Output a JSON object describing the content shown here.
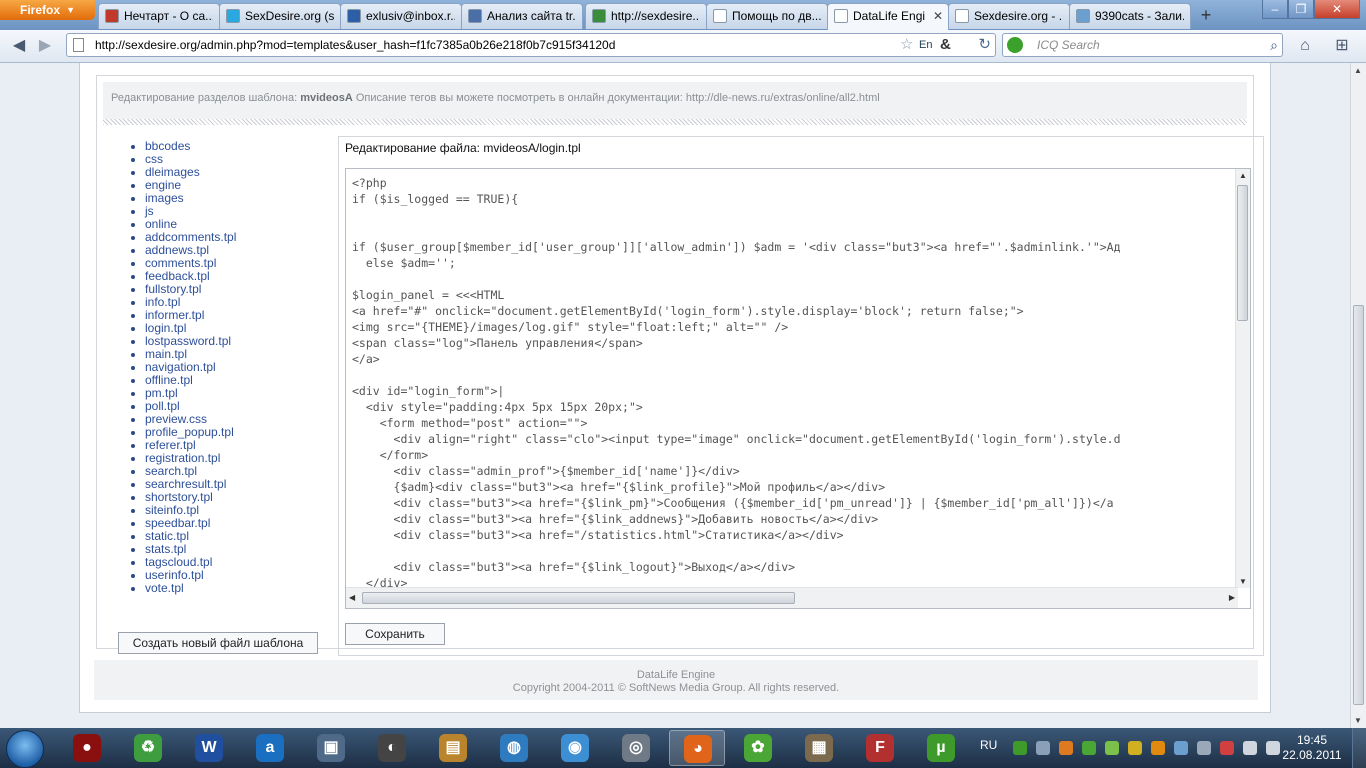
{
  "browser": {
    "menu_button": "Firefox",
    "tabs": [
      {
        "label": "Нечтарт - О са...",
        "icon": "chart-icon",
        "color": "#c0392b"
      },
      {
        "label": "SexDesire.org (s...",
        "icon": "twitter-bird-icon",
        "color": "#2aa9e0"
      },
      {
        "label": "exlusiv@inbox.r...",
        "icon": "mail-at-icon",
        "color": "#2d5fa6"
      },
      {
        "label": "Анализ сайта tr...",
        "icon": "pen-icon",
        "color": "#4a6fa8"
      },
      {
        "label": "http://sexdesire....",
        "icon": "google-icon",
        "color": "#3a8d3a"
      },
      {
        "label": "Помощь по дв...",
        "icon": "page-icon",
        "color": "#ffffff"
      },
      {
        "label": "DataLife Engi...",
        "icon": "page-icon",
        "color": "#ffffff",
        "active": true
      },
      {
        "label": "Sexdesire.org - ...",
        "icon": "page-icon",
        "color": "#ffffff"
      },
      {
        "label": "9390cats - Зали...",
        "icon": "image-icon",
        "color": "#6a9fd0"
      }
    ],
    "new_tab": "+",
    "url": "http://sexdesire.org/admin.php?mod=templates&user_hash=f1fc7385a0b26e218f0b7c915f34120d",
    "lang_badge": "En",
    "search_placeholder": "ICQ Search"
  },
  "page": {
    "header_prefix": "Редактирование разделов шаблона:",
    "template_name": "mvideosA",
    "header_suffix": "Описание тегов вы можете посмотреть в онлайн документации: http://dle-news.ru/extras/online/all2.html",
    "files": [
      "bbcodes",
      "css",
      "dleimages",
      "engine",
      "images",
      "js",
      "online",
      "addcomments.tpl",
      "addnews.tpl",
      "comments.tpl",
      "feedback.tpl",
      "fullstory.tpl",
      "info.tpl",
      "informer.tpl",
      "login.tpl",
      "lostpassword.tpl",
      "main.tpl",
      "navigation.tpl",
      "offline.tpl",
      "pm.tpl",
      "poll.tpl",
      "preview.css",
      "profile_popup.tpl",
      "referer.tpl",
      "registration.tpl",
      "search.tpl",
      "searchresult.tpl",
      "shortstory.tpl",
      "siteinfo.tpl",
      "speedbar.tpl",
      "static.tpl",
      "stats.tpl",
      "tagscloud.tpl",
      "userinfo.tpl",
      "vote.tpl"
    ],
    "new_file_button": "Создать новый файл шаблона",
    "editor_title": "Редактирование файла: mvideosA/login.tpl",
    "code_lines": [
      "<?php",
      "if ($is_logged == TRUE){",
      "",
      "",
      "if ($user_group[$member_id['user_group']]['allow_admin']) $adm = '<div class=\"but3\"><a href=\"'.$adminlink.'\">Ад",
      "  else $adm='';",
      "",
      "$login_panel = <<<HTML",
      "<a href=\"#\" onclick=\"document.getElementById('login_form').style.display='block'; return false;\">",
      "<img src=\"{THEME}/images/log.gif\" style=\"float:left;\" alt=\"\" />",
      "<span class=\"log\">Панель управления</span>",
      "</a>",
      "",
      "<div id=\"login_form\">|",
      "  <div style=\"padding:4px 5px 15px 20px;\">",
      "    <form method=\"post\" action=\"\">",
      "      <div align=\"right\" class=\"clo\"><input type=\"image\" onclick=\"document.getElementById('login_form').style.d",
      "    </form>",
      "      <div class=\"admin_prof\">{$member_id['name']}</div>",
      "      {$adm}<div class=\"but3\"><a href=\"{$link_profile}\">Мой профиль</a></div>",
      "      <div class=\"but3\"><a href=\"{$link_pm}\">Сообщения ({$member_id['pm_unread']} | {$member_id['pm_all']})</a",
      "      <div class=\"but3\"><a href=\"{$link_addnews}\">Добавить новость</a></div>",
      "      <div class=\"but3\"><a href=\"/statistics.html\">Статистика</a></div>",
      "",
      "      <div class=\"but3\"><a href=\"{$link_logout}\">Выход</a></div>",
      "  </div>"
    ],
    "save_button": "Сохранить",
    "footer_line1": "DataLife Engine",
    "footer_line2": "Copyright 2004-2011 © SoftNews Media Group. All rights reserved."
  },
  "taskbar": {
    "apps": [
      {
        "name": "app-red-icon",
        "glyph": "●",
        "color": "#8a1010"
      },
      {
        "name": "recycle-icon",
        "glyph": "♻",
        "color": "#3e9d3e"
      },
      {
        "name": "word-icon",
        "glyph": "W",
        "color": "#1f4f9e"
      },
      {
        "name": "app-a-icon",
        "glyph": "a",
        "color": "#1a6fc0"
      },
      {
        "name": "computer-icon",
        "glyph": "▣",
        "color": "#4f6a88"
      },
      {
        "name": "disc-icon",
        "glyph": "◐",
        "color": "#444444"
      },
      {
        "name": "folders-icon",
        "glyph": "▤",
        "color": "#b9842c"
      },
      {
        "name": "globe-icon",
        "glyph": "◍",
        "color": "#2e7bbf"
      },
      {
        "name": "chrome-icon",
        "glyph": "◉",
        "color": "#3d8fd4"
      },
      {
        "name": "network-globe-icon",
        "glyph": "◎",
        "color": "#6f7a86"
      },
      {
        "name": "firefox-icon",
        "glyph": "◕",
        "color": "#e0651b",
        "active": true
      },
      {
        "name": "icq-icon",
        "glyph": "✿",
        "color": "#4aa635"
      },
      {
        "name": "media-icon",
        "glyph": "▦",
        "color": "#7c6a4f"
      },
      {
        "name": "filezilla-icon",
        "glyph": "F",
        "color": "#b23030"
      },
      {
        "name": "utorrent-icon",
        "glyph": "µ",
        "color": "#3f9a2c"
      }
    ],
    "lang": "RU",
    "tray_icons": [
      {
        "name": "utorrent-tray-icon",
        "color": "#3f9a2c"
      },
      {
        "name": "network-tray-icon",
        "color": "#8aa0b8"
      },
      {
        "name": "fire-tray-icon",
        "color": "#e07a20"
      },
      {
        "name": "icq-tray-icon",
        "color": "#4aa635"
      },
      {
        "name": "network-tray-icon-2",
        "color": "#7bc04a"
      },
      {
        "name": "warning-tray-icon",
        "color": "#d0b020"
      },
      {
        "name": "square-tray-icon",
        "color": "#e08a10"
      },
      {
        "name": "display-tray-icon",
        "color": "#6a9fd0"
      },
      {
        "name": "usb-tray-icon",
        "color": "#9aa8b8"
      },
      {
        "name": "flag-tray-icon",
        "color": "#d04040"
      },
      {
        "name": "volume-tray-icon",
        "color": "#cfd6de"
      },
      {
        "name": "signal-tray-icon",
        "color": "#cfd6de"
      }
    ],
    "time": "19:45",
    "date": "22.08.2011"
  }
}
